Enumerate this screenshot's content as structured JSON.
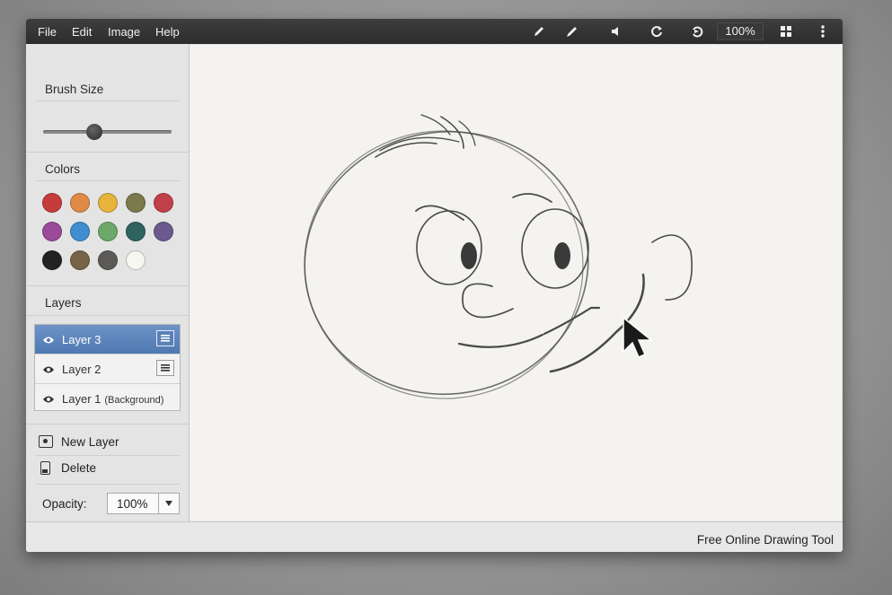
{
  "menu": {
    "file": "File",
    "edit": "Edit",
    "image": "Image",
    "help": "Help"
  },
  "toolbar": {
    "zoom": "100%"
  },
  "sidebar": {
    "brush_title": "Brush Size",
    "brush_value": 0.4,
    "colors_title": "Colors",
    "colors": [
      "#c63b3b",
      "#e08a45",
      "#e6b43c",
      "#7a7a4c",
      "#c2404a",
      "#9b4a9a",
      "#3f8fd0",
      "#6da86a",
      "#2f6360",
      "#6c5a8e",
      "#222222",
      "#756447",
      "#5b5a57",
      "#f7f7f2"
    ],
    "layers_title": "Layers",
    "layers": [
      {
        "name": "Layer 3",
        "sub": ""
      },
      {
        "name": "Layer 2",
        "sub": ""
      },
      {
        "name": "Layer 1",
        "sub": "(Background)"
      }
    ],
    "new_layer": "New Layer",
    "delete": "Delete",
    "opacity_label": "Opacity:",
    "opacity_value": "100%"
  },
  "status": {
    "text": "Free Online Drawing Tool"
  }
}
